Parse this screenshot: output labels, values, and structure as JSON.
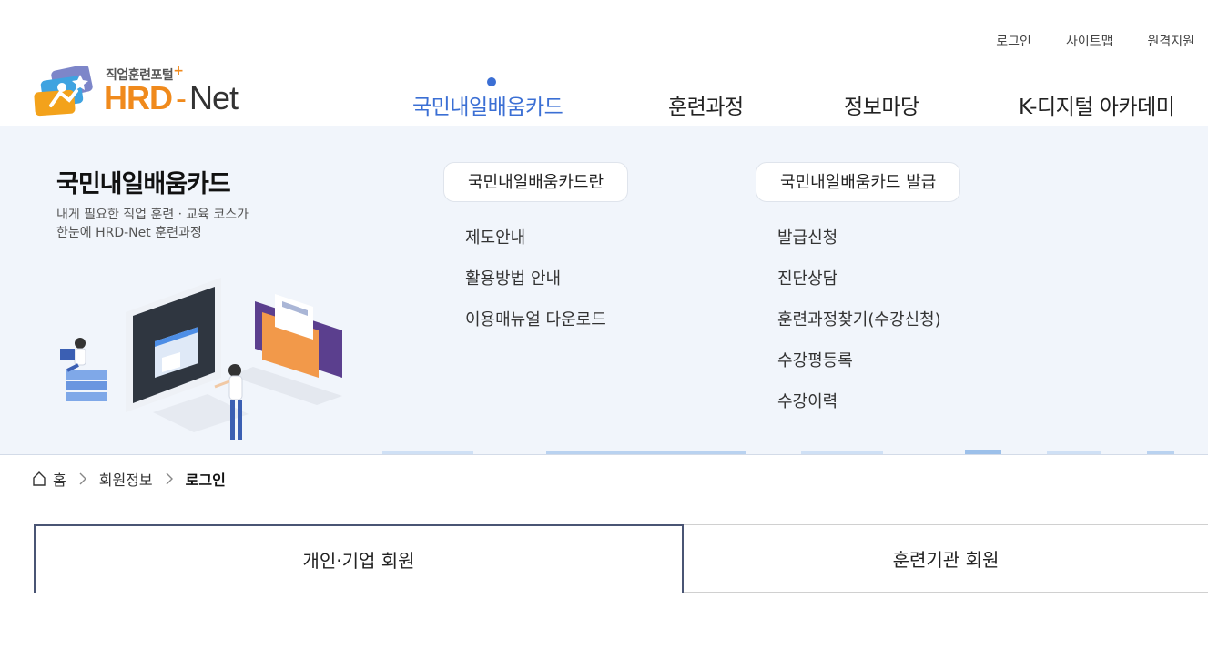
{
  "utility": {
    "login": "로그인",
    "sitemap": "사이트맵",
    "remote_support": "원격지원"
  },
  "logo": {
    "tagline": "직업훈련포털",
    "plus": "+",
    "brand_hrd": "HRD",
    "brand_dash": "-",
    "brand_net": "Net"
  },
  "gnb": {
    "items": [
      "국민내일배움카드",
      "훈련과정",
      "정보마당",
      "K-디지털 아카데미"
    ],
    "active_index": 0
  },
  "mega": {
    "title": "국민내일배움카드",
    "desc_line1": "내게 필요한 직업 훈련ㆍ교육 코스가",
    "desc_line2": "한눈에 HRD-Net 훈련과정",
    "col1": {
      "heading": "국민내일배움카드란",
      "items": [
        "제도안내",
        "활용방법 안내",
        "이용매뉴얼 다운로드"
      ]
    },
    "col2": {
      "heading": "국민내일배움카드 발급",
      "items": [
        "발급신청",
        "진단상담",
        "훈련과정찾기(수강신청)",
        "수강평등록",
        "수강이력"
      ]
    }
  },
  "breadcrumb": {
    "home": "홈",
    "level1": "회원정보",
    "current": "로그인"
  },
  "tabs": {
    "personal": "개인·기업 회원",
    "institution": "훈련기관 회원"
  },
  "colors": {
    "accent": "#3b6fd4",
    "brand_orange": "#f08a1c",
    "mega_bg": "#f1f5fb",
    "tab_border": "#4a5574"
  }
}
